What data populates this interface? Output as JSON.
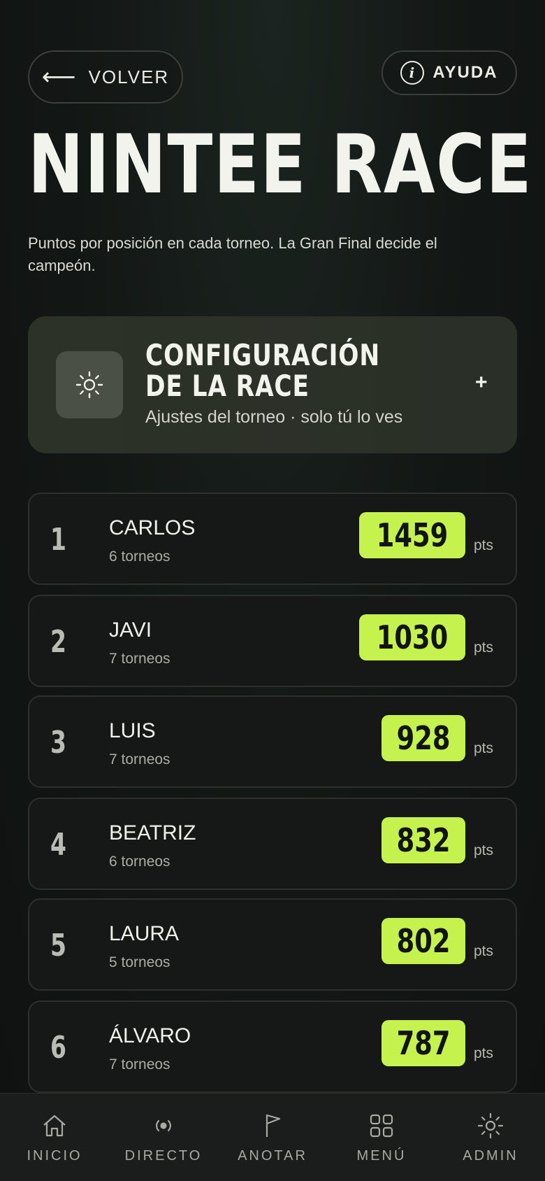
{
  "header": {
    "back_label": "VOLVER",
    "back_arrow": "⟵",
    "help_label": "AYUDA",
    "help_icon_glyph": "i"
  },
  "page": {
    "title": "NINTEE RACE",
    "subtitle": "Puntos por posición en cada torneo. La Gran Final decide el campeón."
  },
  "config": {
    "title": "CONFIGURACIÓN DE LA RACE",
    "subtitle": "Ajustes del torneo · solo tú lo ves",
    "expand_glyph": "+"
  },
  "ranking": {
    "points_unit": "pts",
    "rows": [
      {
        "position": "1",
        "name": "CARLOS",
        "tournaments": "6 torneos",
        "points": "1459"
      },
      {
        "position": "2",
        "name": "JAVI",
        "tournaments": "7 torneos",
        "points": "1030"
      },
      {
        "position": "3",
        "name": "LUIS",
        "tournaments": "7 torneos",
        "points": "928"
      },
      {
        "position": "4",
        "name": "BEATRIZ",
        "tournaments": "6 torneos",
        "points": "832"
      },
      {
        "position": "5",
        "name": "LAURA",
        "tournaments": "5 torneos",
        "points": "802"
      },
      {
        "position": "6",
        "name": "ÁLVARO",
        "tournaments": "7 torneos",
        "points": "787"
      }
    ]
  },
  "nav": {
    "items": [
      {
        "label": "INICIO",
        "icon": "home-icon"
      },
      {
        "label": "DIRECTO",
        "icon": "live-broadcast-icon"
      },
      {
        "label": "ANOTAR",
        "icon": "flag-icon"
      },
      {
        "label": "MENÚ",
        "icon": "grid-icon"
      },
      {
        "label": "ADMIN",
        "icon": "sun-icon"
      }
    ]
  },
  "colors": {
    "accent": "#c6f24e",
    "background": "#121614",
    "card": "#2b3027"
  }
}
